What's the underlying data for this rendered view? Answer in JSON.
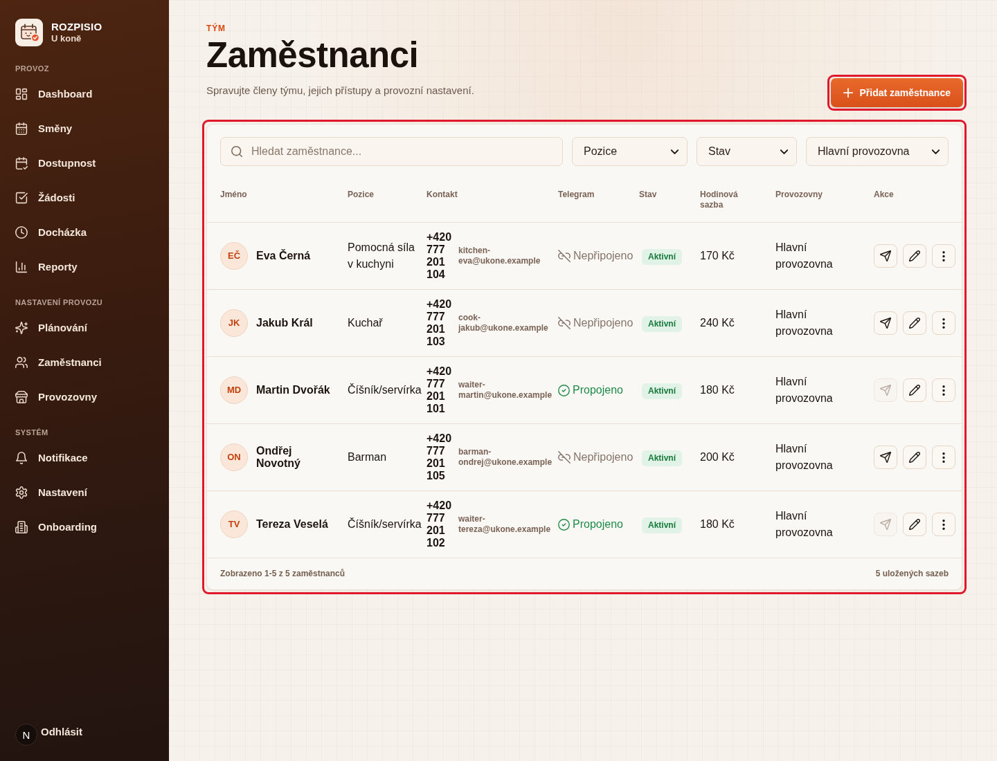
{
  "sidebar": {
    "brand": {
      "name": "ROZPISIO",
      "subtitle": "U koně"
    },
    "sections": [
      {
        "title": "PROVOZ",
        "items": [
          {
            "label": "Dashboard",
            "selected": false
          },
          {
            "label": "Směny",
            "selected": false
          },
          {
            "label": "Dostupnost",
            "selected": false
          },
          {
            "label": "Žádosti",
            "selected": false
          },
          {
            "label": "Docházka",
            "selected": false
          },
          {
            "label": "Reporty",
            "selected": false
          }
        ]
      },
      {
        "title": "NASTAVENÍ PROVOZU",
        "items": [
          {
            "label": "Plánování",
            "selected": false
          },
          {
            "label": "Zaměstnanci",
            "selected": false
          },
          {
            "label": "Provozovny",
            "selected": false
          }
        ]
      },
      {
        "title": "SYSTÉM",
        "items": [
          {
            "label": "Notifikace",
            "selected": false
          },
          {
            "label": "Nastavení",
            "selected": false
          },
          {
            "label": "Onboarding",
            "selected": false
          }
        ]
      }
    ],
    "logout": {
      "badge": "N",
      "label": "Odhlásit"
    }
  },
  "header": {
    "eyebrow": "TÝM",
    "title": "Zaměstnanci",
    "subtitle": "Spravujte členy týmu, jejich přístupy a provozní nastavení.",
    "add_button": {
      "label": "Přidat zaměstnance",
      "highlighted": true
    }
  },
  "panel": {
    "highlighted": true,
    "search": {
      "placeholder": "Hledat zaměstnance..."
    },
    "filters": [
      {
        "value": "Pozice"
      },
      {
        "value": "Stav"
      },
      {
        "value": "Hlavní provozovna"
      }
    ],
    "table": {
      "columns": [
        "Jméno",
        "Pozice",
        "Kontakt",
        "Telegram",
        "Stav",
        "Hodinová sazba",
        "Provozovny",
        "Akce"
      ],
      "rows": [
        {
          "initials": "EČ",
          "name": "Eva Černá",
          "position": "Pomocná síla v kuchyni",
          "phone": "+420 777 201 104",
          "email": "kitchen-eva@ukone.example",
          "telegram": {
            "label": "Nepřipojeno",
            "connected": false
          },
          "status": {
            "label": "Aktivní",
            "active": true
          },
          "rate": "170 Kč",
          "locations": "Hlavní provozovna",
          "send_disabled": false
        },
        {
          "initials": "JK",
          "name": "Jakub Král",
          "position": "Kuchař",
          "phone": "+420 777 201 103",
          "email": "cook-jakub@ukone.example",
          "telegram": {
            "label": "Nepřipojeno",
            "connected": false
          },
          "status": {
            "label": "Aktivní",
            "active": true
          },
          "rate": "240 Kč",
          "locations": "Hlavní provozovna",
          "send_disabled": false
        },
        {
          "initials": "MD",
          "name": "Martin Dvořák",
          "position": "Číšník/servírka",
          "phone": "+420 777 201 101",
          "email": "waiter-martin@ukone.example",
          "telegram": {
            "label": "Propojeno",
            "connected": true
          },
          "status": {
            "label": "Aktivní",
            "active": true
          },
          "rate": "180 Kč",
          "locations": "Hlavní provozovna",
          "send_disabled": true
        },
        {
          "initials": "ON",
          "name": "Ondřej Novotný",
          "position": "Barman",
          "phone": "+420 777 201 105",
          "email": "barman-ondrej@ukone.example",
          "telegram": {
            "label": "Nepřipojeno",
            "connected": false
          },
          "status": {
            "label": "Aktivní",
            "active": true
          },
          "rate": "200 Kč",
          "locations": "Hlavní provozovna",
          "send_disabled": false
        },
        {
          "initials": "TV",
          "name": "Tereza Veselá",
          "position": "Číšník/servírka",
          "phone": "+420 777 201 102",
          "email": "waiter-tereza@ukone.example",
          "telegram": {
            "label": "Propojeno",
            "connected": true
          },
          "status": {
            "label": "Aktivní",
            "active": true
          },
          "rate": "180 Kč",
          "locations": "Hlavní provozovna",
          "send_disabled": true
        }
      ]
    },
    "footer": {
      "summary": "Zobrazeno 1-5 z 5 zaměstnanců",
      "rates": "5 uložených sazeb"
    }
  }
}
